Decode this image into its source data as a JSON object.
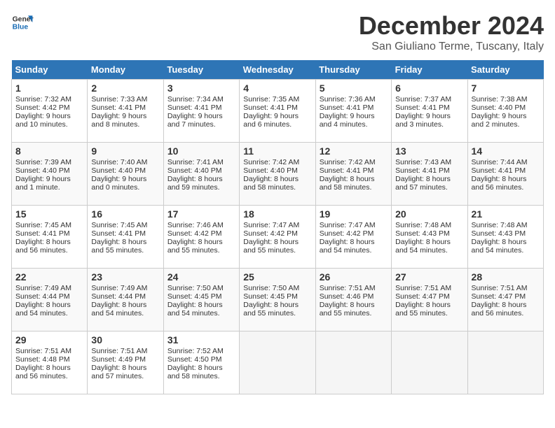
{
  "logo": {
    "line1": "General",
    "line2": "Blue"
  },
  "title": "December 2024",
  "location": "San Giuliano Terme, Tuscany, Italy",
  "days_header": [
    "Sunday",
    "Monday",
    "Tuesday",
    "Wednesday",
    "Thursday",
    "Friday",
    "Saturday"
  ],
  "weeks": [
    [
      {
        "day": "1",
        "sr": "7:32 AM",
        "ss": "4:42 PM",
        "dl": "9 hours and 10 minutes."
      },
      {
        "day": "2",
        "sr": "7:33 AM",
        "ss": "4:41 PM",
        "dl": "9 hours and 8 minutes."
      },
      {
        "day": "3",
        "sr": "7:34 AM",
        "ss": "4:41 PM",
        "dl": "9 hours and 7 minutes."
      },
      {
        "day": "4",
        "sr": "7:35 AM",
        "ss": "4:41 PM",
        "dl": "9 hours and 6 minutes."
      },
      {
        "day": "5",
        "sr": "7:36 AM",
        "ss": "4:41 PM",
        "dl": "9 hours and 4 minutes."
      },
      {
        "day": "6",
        "sr": "7:37 AM",
        "ss": "4:41 PM",
        "dl": "9 hours and 3 minutes."
      },
      {
        "day": "7",
        "sr": "7:38 AM",
        "ss": "4:40 PM",
        "dl": "9 hours and 2 minutes."
      }
    ],
    [
      {
        "day": "8",
        "sr": "7:39 AM",
        "ss": "4:40 PM",
        "dl": "9 hours and 1 minute."
      },
      {
        "day": "9",
        "sr": "7:40 AM",
        "ss": "4:40 PM",
        "dl": "9 hours and 0 minutes."
      },
      {
        "day": "10",
        "sr": "7:41 AM",
        "ss": "4:40 PM",
        "dl": "8 hours and 59 minutes."
      },
      {
        "day": "11",
        "sr": "7:42 AM",
        "ss": "4:40 PM",
        "dl": "8 hours and 58 minutes."
      },
      {
        "day": "12",
        "sr": "7:42 AM",
        "ss": "4:41 PM",
        "dl": "8 hours and 58 minutes."
      },
      {
        "day": "13",
        "sr": "7:43 AM",
        "ss": "4:41 PM",
        "dl": "8 hours and 57 minutes."
      },
      {
        "day": "14",
        "sr": "7:44 AM",
        "ss": "4:41 PM",
        "dl": "8 hours and 56 minutes."
      }
    ],
    [
      {
        "day": "15",
        "sr": "7:45 AM",
        "ss": "4:41 PM",
        "dl": "8 hours and 56 minutes."
      },
      {
        "day": "16",
        "sr": "7:45 AM",
        "ss": "4:41 PM",
        "dl": "8 hours and 55 minutes."
      },
      {
        "day": "17",
        "sr": "7:46 AM",
        "ss": "4:42 PM",
        "dl": "8 hours and 55 minutes."
      },
      {
        "day": "18",
        "sr": "7:47 AM",
        "ss": "4:42 PM",
        "dl": "8 hours and 55 minutes."
      },
      {
        "day": "19",
        "sr": "7:47 AM",
        "ss": "4:42 PM",
        "dl": "8 hours and 54 minutes."
      },
      {
        "day": "20",
        "sr": "7:48 AM",
        "ss": "4:43 PM",
        "dl": "8 hours and 54 minutes."
      },
      {
        "day": "21",
        "sr": "7:48 AM",
        "ss": "4:43 PM",
        "dl": "8 hours and 54 minutes."
      }
    ],
    [
      {
        "day": "22",
        "sr": "7:49 AM",
        "ss": "4:44 PM",
        "dl": "8 hours and 54 minutes."
      },
      {
        "day": "23",
        "sr": "7:49 AM",
        "ss": "4:44 PM",
        "dl": "8 hours and 54 minutes."
      },
      {
        "day": "24",
        "sr": "7:50 AM",
        "ss": "4:45 PM",
        "dl": "8 hours and 54 minutes."
      },
      {
        "day": "25",
        "sr": "7:50 AM",
        "ss": "4:45 PM",
        "dl": "8 hours and 55 minutes."
      },
      {
        "day": "26",
        "sr": "7:51 AM",
        "ss": "4:46 PM",
        "dl": "8 hours and 55 minutes."
      },
      {
        "day": "27",
        "sr": "7:51 AM",
        "ss": "4:47 PM",
        "dl": "8 hours and 55 minutes."
      },
      {
        "day": "28",
        "sr": "7:51 AM",
        "ss": "4:47 PM",
        "dl": "8 hours and 56 minutes."
      }
    ],
    [
      {
        "day": "29",
        "sr": "7:51 AM",
        "ss": "4:48 PM",
        "dl": "8 hours and 56 minutes."
      },
      {
        "day": "30",
        "sr": "7:51 AM",
        "ss": "4:49 PM",
        "dl": "8 hours and 57 minutes."
      },
      {
        "day": "31",
        "sr": "7:52 AM",
        "ss": "4:50 PM",
        "dl": "8 hours and 58 minutes."
      },
      null,
      null,
      null,
      null
    ]
  ]
}
